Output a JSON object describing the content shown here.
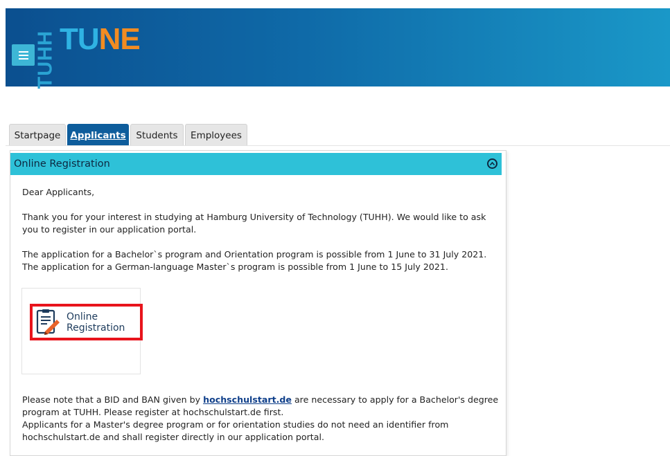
{
  "header": {
    "menu_icon": "hamburger-menu-icon",
    "logo": {
      "part1": "TUHH",
      "part2a": "TU",
      "part2b": "NE"
    },
    "colors": {
      "bar_start": "#0b4f8f",
      "bar_end": "#1a98c8",
      "logo_orange": "#f28c22",
      "logo_blue": "#2fb3e3"
    }
  },
  "tabs": [
    {
      "label": "Startpage",
      "active": false
    },
    {
      "label": "Applicants",
      "active": true
    },
    {
      "label": "Students",
      "active": false
    },
    {
      "label": "Employees",
      "active": false
    }
  ],
  "panel": {
    "title": "Online Registration",
    "collapse_icon": "chevron-up-circle-icon",
    "greeting": "Dear Applicants,",
    "intro": "Thank you for your interest in studying at Hamburg University of Technology (TUHH). We would like to ask you to register in our application portal.",
    "bachelor_line": "The application for a Bachelor`s program and Orientation program is possible from 1 June to 31 July 2021.",
    "master_line": "The application for a German-language Master`s program is possible from 1 June to 15 July 2021.",
    "registration_button": {
      "icon": "registration-form-pencil-icon",
      "line1": "Online",
      "line2": "Registration"
    },
    "note_before_link": "Please note that a BID and BAN given by",
    "note_link": "hochschulstart.de",
    "note_after_link": "are necessary to apply for a Bachelor's degree program at TUHH. Please register at hochschulstart.de first.",
    "note_master": "Applicants for a Master's degree program or for orientation studies do not need an identifier from hochschulstart.de and shall register directly in our application portal."
  },
  "colors": {
    "panel_header": "#2ec1d8",
    "active_tab": "#0e5d9c",
    "highlight": "#e8141c"
  }
}
